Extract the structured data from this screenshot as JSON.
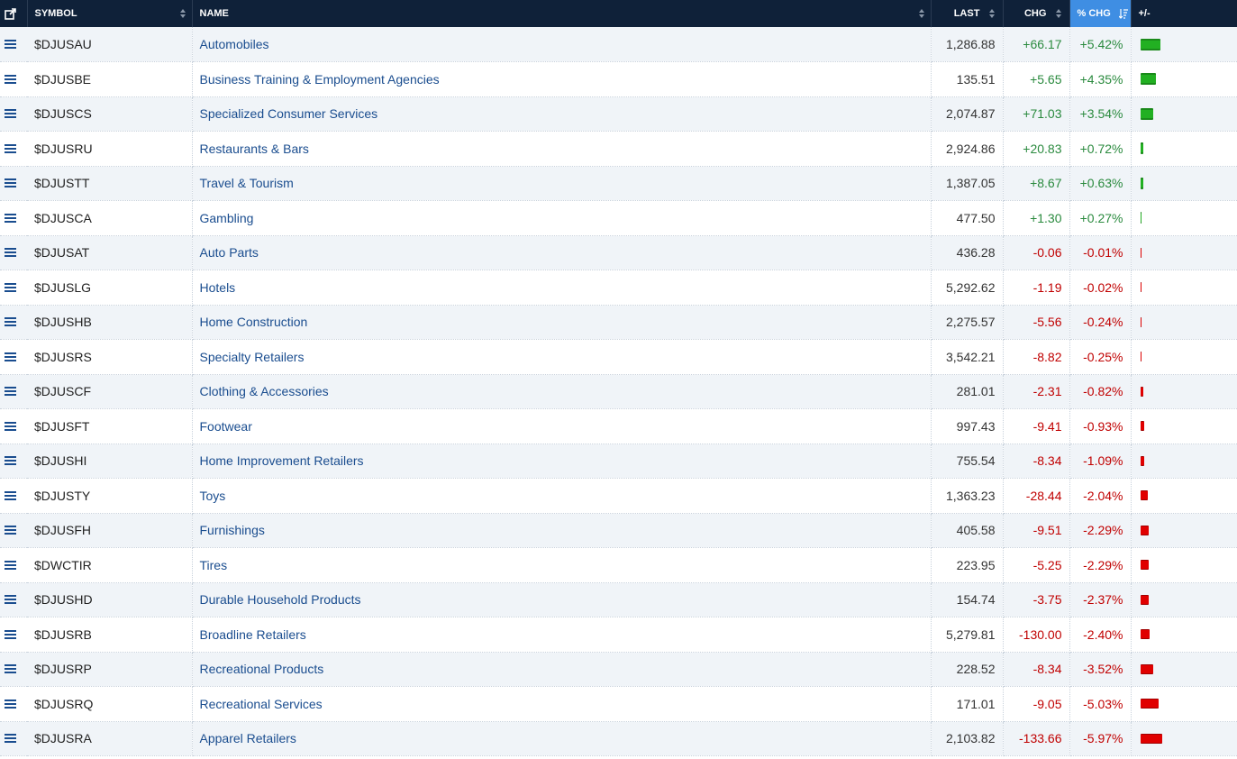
{
  "header": {
    "symbol": "SYMBOL",
    "name": "NAME",
    "last": "LAST",
    "chg": "CHG",
    "pct_chg": "% CHG",
    "plus_minus": "+/-",
    "popout_icon": "external-link-icon",
    "sort_icon": "sort-arrows-icon",
    "sorted_desc_icon": "sort-descending-icon"
  },
  "colors": {
    "header_bg": "#0f2139",
    "active_header": "#3f8ee3",
    "positive": "#2a8a3e",
    "negative": "#c00000",
    "link": "#1a4d8f"
  },
  "rows": [
    {
      "symbol": "$DJUSAU",
      "name": "Automobiles",
      "last": "1,286.88",
      "chg": "+66.17",
      "pct": "+5.42%"
    },
    {
      "symbol": "$DJUSBE",
      "name": "Business Training & Employment Agencies",
      "last": "135.51",
      "chg": "+5.65",
      "pct": "+4.35%"
    },
    {
      "symbol": "$DJUSCS",
      "name": "Specialized Consumer Services",
      "last": "2,074.87",
      "chg": "+71.03",
      "pct": "+3.54%"
    },
    {
      "symbol": "$DJUSRU",
      "name": "Restaurants & Bars",
      "last": "2,924.86",
      "chg": "+20.83",
      "pct": "+0.72%"
    },
    {
      "symbol": "$DJUSTT",
      "name": "Travel & Tourism",
      "last": "1,387.05",
      "chg": "+8.67",
      "pct": "+0.63%"
    },
    {
      "symbol": "$DJUSCA",
      "name": "Gambling",
      "last": "477.50",
      "chg": "+1.30",
      "pct": "+0.27%"
    },
    {
      "symbol": "$DJUSAT",
      "name": "Auto Parts",
      "last": "436.28",
      "chg": "-0.06",
      "pct": "-0.01%"
    },
    {
      "symbol": "$DJUSLG",
      "name": "Hotels",
      "last": "5,292.62",
      "chg": "-1.19",
      "pct": "-0.02%"
    },
    {
      "symbol": "$DJUSHB",
      "name": "Home Construction",
      "last": "2,275.57",
      "chg": "-5.56",
      "pct": "-0.24%"
    },
    {
      "symbol": "$DJUSRS",
      "name": "Specialty Retailers",
      "last": "3,542.21",
      "chg": "-8.82",
      "pct": "-0.25%"
    },
    {
      "symbol": "$DJUSCF",
      "name": "Clothing & Accessories",
      "last": "281.01",
      "chg": "-2.31",
      "pct": "-0.82%"
    },
    {
      "symbol": "$DJUSFT",
      "name": "Footwear",
      "last": "997.43",
      "chg": "-9.41",
      "pct": "-0.93%"
    },
    {
      "symbol": "$DJUSHI",
      "name": "Home Improvement Retailers",
      "last": "755.54",
      "chg": "-8.34",
      "pct": "-1.09%"
    },
    {
      "symbol": "$DJUSTY",
      "name": "Toys",
      "last": "1,363.23",
      "chg": "-28.44",
      "pct": "-2.04%"
    },
    {
      "symbol": "$DJUSFH",
      "name": "Furnishings",
      "last": "405.58",
      "chg": "-9.51",
      "pct": "-2.29%"
    },
    {
      "symbol": "$DWCTIR",
      "name": "Tires",
      "last": "223.95",
      "chg": "-5.25",
      "pct": "-2.29%"
    },
    {
      "symbol": "$DJUSHD",
      "name": "Durable Household Products",
      "last": "154.74",
      "chg": "-3.75",
      "pct": "-2.37%"
    },
    {
      "symbol": "$DJUSRB",
      "name": "Broadline Retailers",
      "last": "5,279.81",
      "chg": "-130.00",
      "pct": "-2.40%"
    },
    {
      "symbol": "$DJUSRP",
      "name": "Recreational Products",
      "last": "228.52",
      "chg": "-8.34",
      "pct": "-3.52%"
    },
    {
      "symbol": "$DJUSRQ",
      "name": "Recreational Services",
      "last": "171.01",
      "chg": "-9.05",
      "pct": "-5.03%"
    },
    {
      "symbol": "$DJUSRA",
      "name": "Apparel Retailers",
      "last": "2,103.82",
      "chg": "-133.66",
      "pct": "-5.97%"
    }
  ]
}
